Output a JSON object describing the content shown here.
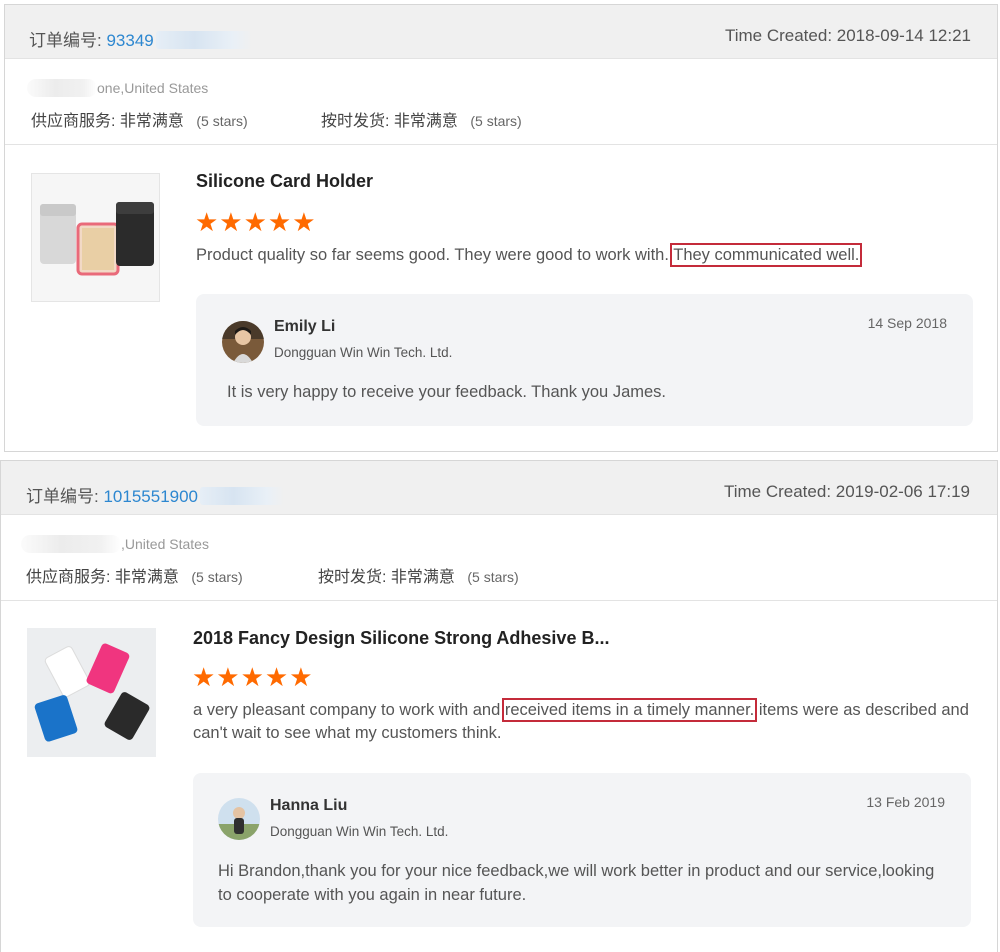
{
  "reviews": [
    {
      "order_label": "订单编号:",
      "order_number": "93349",
      "time_created": "Time Created: 2018-09-14 12:21",
      "location": "one,United States",
      "supplier_service": {
        "label": "供应商服务:",
        "value": "非常满意",
        "stars_text": "(5 stars)"
      },
      "shipping": {
        "label": "按时发货:",
        "value": "非常满意",
        "stars_text": "(5 stars)"
      },
      "product_title": "Silicone Card Holder",
      "rating": 5,
      "stars": "★★★★★",
      "review_before": "Product quality so far seems good. They were good to work with.",
      "review_highlight": "They communicated well.",
      "review_after": "",
      "reply": {
        "name": "Emily Li",
        "company": "Dongguan Win Win Tech. Ltd.",
        "date": "14 Sep 2018",
        "text": "It is very happy to receive your feedback. Thank you James."
      }
    },
    {
      "order_label": "订单编号:",
      "order_number": "1015551900",
      "time_created": "Time Created: 2019-02-06 17:19",
      "location": ",United States",
      "supplier_service": {
        "label": "供应商服务:",
        "value": "非常满意",
        "stars_text": "(5 stars)"
      },
      "shipping": {
        "label": "按时发货:",
        "value": "非常满意",
        "stars_text": "(5 stars)"
      },
      "product_title": "2018 Fancy Design Silicone Strong Adhesive B...",
      "rating": 5,
      "stars": "★★★★★",
      "review_before": "a very pleasant company to work with and ",
      "review_highlight": "received items in a timely manner.",
      "review_after": " items were as described and can't wait to see what my customers think.",
      "reply": {
        "name": "Hanna Liu",
        "company": "Dongguan Win Win Tech. Ltd.",
        "date": "13 Feb 2019",
        "text": "Hi Brandon,thank you for your nice feedback,we will work better in product and our service,looking to cooperate with you again in near future."
      }
    }
  ],
  "colors": {
    "star": "#ff6a00",
    "order_link": "#2d87d0",
    "highlight_box": "#c42b3a"
  }
}
